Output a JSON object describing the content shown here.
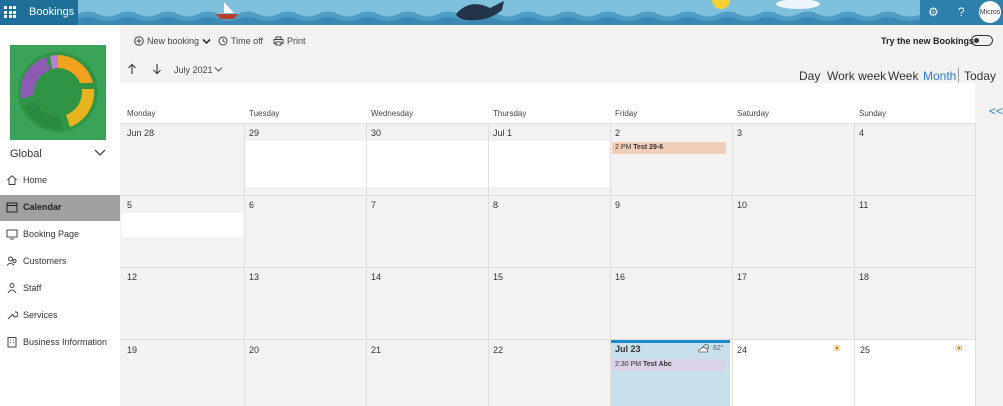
{
  "app": {
    "name": "Bookings",
    "avatar_text": "Micros"
  },
  "sidebar": {
    "scope": "Global",
    "items": [
      {
        "label": "Home",
        "icon": "home-icon"
      },
      {
        "label": "Calendar",
        "icon": "calendar-icon",
        "selected": true
      },
      {
        "label": "Booking Page",
        "icon": "monitor-icon"
      },
      {
        "label": "Customers",
        "icon": "people-icon"
      },
      {
        "label": "Staff",
        "icon": "staff-icon"
      },
      {
        "label": "Services",
        "icon": "wrench-icon"
      },
      {
        "label": "Business Information",
        "icon": "building-icon"
      }
    ]
  },
  "toolbar": {
    "new_booking": "New booking",
    "time_off": "Time off",
    "print": "Print",
    "try_new": "Try the new Bookings"
  },
  "nav": {
    "month": "July 2021"
  },
  "views": [
    "Day",
    "Work week",
    "Week",
    "Month",
    "Today"
  ],
  "calendar": {
    "day_names": [
      "Monday",
      "Tuesday",
      "Wednesday",
      "Thursday",
      "Friday",
      "Saturday",
      "Sunday"
    ],
    "weeks": [
      [
        "Jun 28",
        "29",
        "30",
        "Jul 1",
        "2",
        "3",
        "4"
      ],
      [
        "5",
        "6",
        "7",
        "8",
        "9",
        "10",
        "11"
      ],
      [
        "12",
        "13",
        "14",
        "15",
        "16",
        "17",
        "18"
      ],
      [
        "19",
        "20",
        "21",
        "22",
        "Jul 23",
        "24",
        "25"
      ]
    ],
    "events": [
      {
        "time": "2 PM",
        "title": "Test 29-6",
        "color": "#f2cdb9"
      },
      {
        "time": "2:30 PM",
        "title": "Test Abc",
        "color": "#dcd2e8"
      }
    ],
    "weather_today": "62°"
  },
  "colors": {
    "accent": "#2b7cd3",
    "topbar": "#5ba3c7",
    "today_bg": "#c7e0ec"
  }
}
